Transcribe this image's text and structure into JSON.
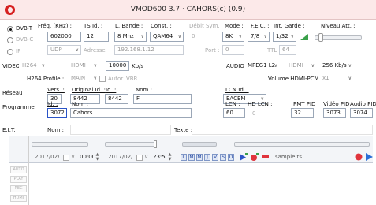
{
  "window": {
    "title": "VMOD600 3.7 · CAHORS(c) (0.9)"
  },
  "input": {
    "dvbt": "DVB-T",
    "dvbc": "DVB-C",
    "ip": "IP",
    "freq_label": "Fréq. (KHz) :",
    "freq_value": "602000",
    "tsid_label": "TS Id. :",
    "tsid_value": "12",
    "bw_label": "L. Bande :",
    "bw_value": "8 Mhz",
    "const_label": "Const. :",
    "const_value": "QAM64",
    "debit_label": "Débit Sym.",
    "debit_value": "0",
    "mode_label": "Mode :",
    "mode_value": "8K",
    "fec_label": "F.E.C. :",
    "fec_value": "7/8",
    "guard_label": "Int. Garde :",
    "guard_value": "1/32",
    "att_label": "Niveau Att. :",
    "proto_value": "UDP",
    "addr_label": "Adresse",
    "addr_value": "192.168.1.12",
    "port_label": "Port :",
    "port_value": "0",
    "ttl_label": "TTL",
    "ttl_value": "64"
  },
  "video": {
    "label": "VIDEO",
    "codec": "H264",
    "source": "HDMI",
    "bitrate": "10000",
    "unit": "Kb/s",
    "profile_label": "H264 Profile :",
    "profile_value": "MAIN",
    "autovbr": "Autor. VBR"
  },
  "audio": {
    "label": "AUDIO",
    "codec": "MPEG1 L2",
    "source": "HDMI",
    "bitrate": "256 Kb/s",
    "vol_label": "Volume HDMI-PCM :",
    "vol_value": "x1"
  },
  "network": {
    "label": "Réseau",
    "vers_label": "Vers. :",
    "vers_value": "30",
    "origid_label": "Original Id. :",
    "origid_value": "8442",
    "id_label": "Id. :",
    "id_value": "8442",
    "name_label": "Nom :",
    "name_value": "F",
    "lcnid_label": "LCN Id. :",
    "lcnid_value": "EACEM"
  },
  "program": {
    "label": "Programme",
    "id_label": "Id. :",
    "id_value": "3072",
    "name_label": "Nom :",
    "name_value": "Cahors",
    "lcn_label": "LCN :",
    "lcn_value": "60",
    "hdlcn_label": "HD LCN :",
    "hdlcn_value": "0",
    "pmt_label": "PMT PID",
    "pmt_value": "32",
    "vpid_label": "Vidéo PID",
    "vpid_value": "3073",
    "apid_label": "Audio PID",
    "apid_value": "3074"
  },
  "eit": {
    "label": "E.I.T.",
    "name_label": "Nom :",
    "text_label": "Texte :"
  },
  "schedule": {
    "date1": "2017/02/23",
    "time1": "00:00",
    "date2": "2017/02/23",
    "time2": "23:59",
    "days": [
      "L",
      "M",
      "M",
      "J",
      "V",
      "S",
      "D"
    ],
    "file": "sample.ts"
  },
  "side": [
    "AUTO",
    "PLAY",
    "REC",
    "HDMI"
  ],
  "colors": {
    "title_bg": "#fce9e9",
    "accent_blue": "#2a54c7",
    "record": "#e0343c",
    "play": "#2b6fd6"
  }
}
